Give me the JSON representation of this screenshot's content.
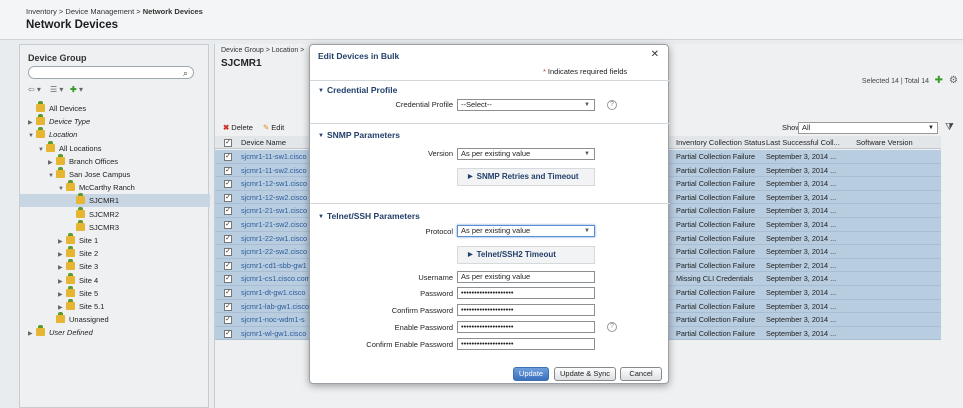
{
  "header": {
    "breadcrumb_prefix": "Inventory > Device Management >",
    "breadcrumb_current": "Network Devices",
    "title": "Network Devices"
  },
  "device_group_panel": {
    "title": "Device Group",
    "search_placeholder": "",
    "tree": [
      {
        "label": "All Devices",
        "indent": 0,
        "arrow": "",
        "italic": false,
        "selected": false
      },
      {
        "label": "Device Type",
        "indent": 0,
        "arrow": "▶",
        "italic": true,
        "selected": false
      },
      {
        "label": "Location",
        "indent": 0,
        "arrow": "▼",
        "italic": true,
        "selected": false
      },
      {
        "label": "All Locations",
        "indent": 1,
        "arrow": "▼",
        "italic": false,
        "selected": false
      },
      {
        "label": "Branch Offices",
        "indent": 2,
        "arrow": "▶",
        "italic": false,
        "selected": false
      },
      {
        "label": "San Jose Campus",
        "indent": 2,
        "arrow": "▼",
        "italic": false,
        "selected": false
      },
      {
        "label": "McCarthy Ranch",
        "indent": 3,
        "arrow": "▼",
        "italic": false,
        "selected": false
      },
      {
        "label": "SJCMR1",
        "indent": 4,
        "arrow": "",
        "italic": false,
        "selected": true
      },
      {
        "label": "SJCMR2",
        "indent": 4,
        "arrow": "",
        "italic": false,
        "selected": false
      },
      {
        "label": "SJCMR3",
        "indent": 4,
        "arrow": "",
        "italic": false,
        "selected": false
      },
      {
        "label": "Site 1",
        "indent": 3,
        "arrow": "▶",
        "italic": false,
        "selected": false
      },
      {
        "label": "Site 2",
        "indent": 3,
        "arrow": "▶",
        "italic": false,
        "selected": false
      },
      {
        "label": "Site 3",
        "indent": 3,
        "arrow": "▶",
        "italic": false,
        "selected": false
      },
      {
        "label": "Site 4",
        "indent": 3,
        "arrow": "▶",
        "italic": false,
        "selected": false
      },
      {
        "label": "Site 5",
        "indent": 3,
        "arrow": "▶",
        "italic": false,
        "selected": false
      },
      {
        "label": "Site 5.1",
        "indent": 3,
        "arrow": "▶",
        "italic": false,
        "selected": false
      },
      {
        "label": "Unassigned",
        "indent": 2,
        "arrow": "",
        "italic": false,
        "selected": false
      },
      {
        "label": "User Defined",
        "indent": 0,
        "arrow": "▶",
        "italic": true,
        "selected": false
      }
    ]
  },
  "devices_panel": {
    "breadcrumb": "Device Group > Location >",
    "title": "SJCMR1",
    "selected_count": "Selected 14 | Total 14",
    "toolbar": {
      "delete_label": "Delete",
      "edit_label": "Edit",
      "show_label": "Show",
      "show_value": "All"
    },
    "columns": {
      "name": "Device Name",
      "status": "Inventory Collection Status",
      "last": "Last Successful Coll...",
      "software": "Software Version"
    },
    "rows": [
      {
        "name": "sjcmr1-11-sw1.cisco",
        "status": "Partial Collection Failure",
        "last": "September 3, 2014 ..."
      },
      {
        "name": "sjcmr1-11-sw2.cisco",
        "status": "Partial Collection Failure",
        "last": "September 3, 2014 ..."
      },
      {
        "name": "sjcmr1-12-sw1.cisco",
        "status": "Partial Collection Failure",
        "last": "September 3, 2014 ..."
      },
      {
        "name": "sjcmr1-12-sw2.cisco",
        "status": "Partial Collection Failure",
        "last": "September 3, 2014 ..."
      },
      {
        "name": "sjcmr1-21-sw1.cisco",
        "status": "Partial Collection Failure",
        "last": "September 3, 2014 ..."
      },
      {
        "name": "sjcmr1-21-sw2.cisco",
        "status": "Partial Collection Failure",
        "last": "September 3, 2014 ..."
      },
      {
        "name": "sjcmr1-22-sw1.cisco",
        "status": "Partial Collection Failure",
        "last": "September 3, 2014 ..."
      },
      {
        "name": "sjcmr1-22-sw2.cisco",
        "status": "Partial Collection Failure",
        "last": "September 3, 2014 ..."
      },
      {
        "name": "sjcmr1-cd1-sbb-gw1",
        "status": "Partial Collection Failure",
        "last": "September 2, 2014 ..."
      },
      {
        "name": "sjcmr1-cs1.cisco.com",
        "status": "Missing CLI Credentials",
        "last": "September 3, 2014 ..."
      },
      {
        "name": "sjcmr1-dt-gw1.cisco",
        "status": "Partial Collection Failure",
        "last": "September 3, 2014 ..."
      },
      {
        "name": "sjcmr1-lab-gw1.cisco",
        "status": "Partial Collection Failure",
        "last": "September 3, 2014 ..."
      },
      {
        "name": "sjcmr1-noc-wdm1-s",
        "status": "Partial Collection Failure",
        "last": "September 3, 2014 ..."
      },
      {
        "name": "sjcmr1-wl-gw1.cisco",
        "status": "Partial Collection Failure",
        "last": "September 3, 2014 ..."
      }
    ]
  },
  "modal": {
    "title": "Edit Devices in Bulk",
    "required_note": "Indicates required fields",
    "credential_profile": {
      "section_title": "Credential Profile",
      "label": "Credential Profile",
      "value": "--Select--"
    },
    "snmp": {
      "section_title": "SNMP Parameters",
      "version_label": "Version",
      "version_value": "As per existing value",
      "retries_label": "SNMP Retries and Timeout"
    },
    "telnet": {
      "section_title": "Telnet/SSH Parameters",
      "protocol_label": "Protocol",
      "protocol_value": "As per existing value",
      "timeout_label": "Telnet/SSH2 Timeout",
      "username_label": "Username",
      "username_value": "As per existing value",
      "password_label": "Password",
      "password_value": "••••••••••••••••••••",
      "confirm_password_label": "Confirm Password",
      "confirm_password_value": "••••••••••••••••••••",
      "enable_password_label": "Enable Password",
      "enable_password_value": "••••••••••••••••••••",
      "confirm_enable_password_label": "Confirm Enable Password",
      "confirm_enable_password_value": "••••••••••••••••••••"
    },
    "buttons": {
      "update": "Update",
      "update_sync": "Update & Sync",
      "cancel": "Cancel"
    }
  }
}
